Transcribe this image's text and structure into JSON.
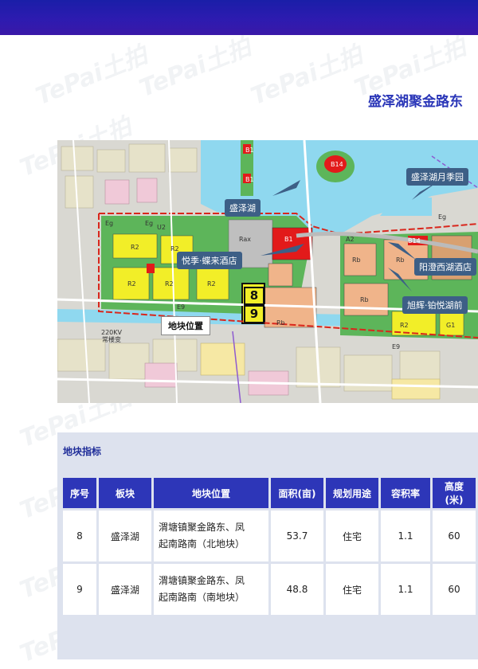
{
  "header": {
    "title": "盛泽湖聚金路东"
  },
  "watermark": {
    "text": "TePai土拍"
  },
  "map": {
    "callouts": {
      "shengzehu": "盛泽湖",
      "yueji": "悦季·蝶来酒店",
      "yuejiyuan": "盛泽湖月季园",
      "yangcheng": "阳澄西湖酒店",
      "xuhui": "旭辉·铂悦湖前"
    },
    "plot_numbers": [
      "8",
      "9"
    ],
    "site_label": "地块位置",
    "substation_line1": "220KV",
    "substation_line2": "常楼变",
    "zone_codes": [
      "B14",
      "B14",
      "R2",
      "R2",
      "R2",
      "R2",
      "R2",
      "R2",
      "Rb",
      "Rb",
      "Rb",
      "Rb",
      "Eg",
      "Eg",
      "Eg",
      "E9",
      "E9",
      "B1",
      "B1",
      "B1",
      "Rax",
      "A2",
      "U2",
      "G1"
    ]
  },
  "panel": {
    "title": "地块指标"
  },
  "table": {
    "headers": [
      "序号",
      "板块",
      "地块位置",
      "面积(亩)",
      "规划用途",
      "容积率",
      "高度\n(米)"
    ],
    "header_height_1": "高度",
    "header_height_2": "(米)",
    "rows": [
      {
        "no": "8",
        "block": "盛泽湖",
        "loc1": "渭塘镇聚金路东、凤",
        "loc2": "起南路南（北地块）",
        "area": "53.7",
        "use": "住宅",
        "far": "1.1",
        "height": "60"
      },
      {
        "no": "9",
        "block": "盛泽湖",
        "loc1": "渭塘镇聚金路东、凤",
        "loc2": "起南路南（南地块）",
        "area": "48.8",
        "use": "住宅",
        "far": "1.1",
        "height": "60"
      }
    ]
  },
  "colors": {
    "header_bar": "#2a1bb0",
    "title": "#2a36b8",
    "table_header": "#2d36b8",
    "panel_bg": "#dde2ee",
    "callout_bg": "#3d5f86",
    "residential": "#f2ee28",
    "water": "#8fd8ef",
    "green": "#5db55a",
    "commercial": "#e21a1a"
  }
}
